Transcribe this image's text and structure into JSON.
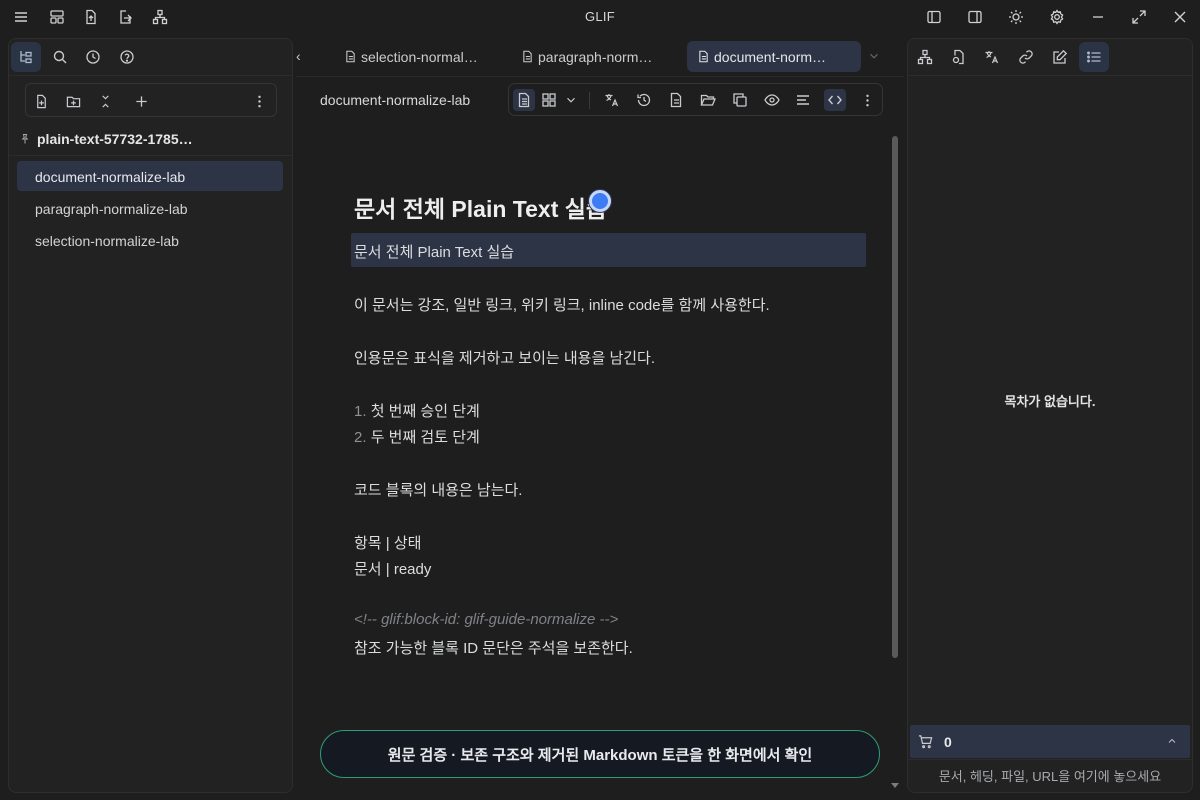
{
  "app": {
    "title": "GLIF"
  },
  "tabs": [
    {
      "label": "selection-normal…"
    },
    {
      "label": "paragraph-norm…"
    },
    {
      "label": "document-norm…"
    }
  ],
  "tab_overflow_label": "‹",
  "sidebar": {
    "vault_name": "plain-text-57732-1785…",
    "files": [
      {
        "label": "document-normalize-lab",
        "active": true
      },
      {
        "label": "paragraph-normalize-lab",
        "active": false
      },
      {
        "label": "selection-normalize-lab",
        "active": false
      }
    ]
  },
  "editor": {
    "breadcrumb": "document-normalize-lab",
    "heading": "문서 전체 Plain Text 실습",
    "highlight_line": "문서 전체 Plain Text 실습",
    "para1": "이 문서는 강조, 일반 링크, 위키 링크, inline code를 함께 사용한다.",
    "para2": "인용문은 표식을 제거하고 보이는 내용을 남긴다.",
    "list": [
      {
        "num": "1.",
        "text": "첫 번째 승인 단계"
      },
      {
        "num": "2.",
        "text": "두 번째 검토 단계"
      }
    ],
    "para3": "코드 블록의 내용은 남는다.",
    "table_row1": "항목 | 상태",
    "table_row2": "문서 | ready",
    "comment": "<!-- glif:block-id: glif-guide-normalize -->",
    "para4": "참조 가능한 블록 ID 문단은 주석을 보존한다.",
    "banner": "원문 검증 · 보존 구조와 제거된 Markdown 토큰을 한 화면에서 확인"
  },
  "right_panel": {
    "toc_empty": "목차가 없습니다.",
    "cart_count": "0",
    "drop_hint": "문서, 헤딩, 파일, URL을 여기에 놓으세요"
  },
  "colors": {
    "accent": "#2d3446",
    "banner_border": "#2d9d79",
    "cursor": "#3d7cf2"
  }
}
